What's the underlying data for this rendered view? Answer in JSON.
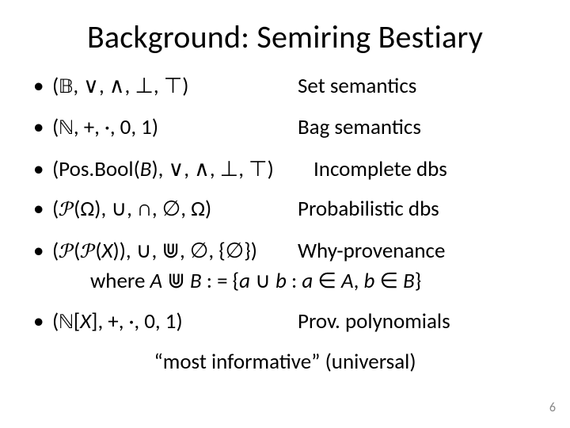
{
  "title": "Background: Semiring Bestiary",
  "items": [
    {
      "lhs_html": "(<span class='bb'>𝔹</span>, ∨, ∧, ⊥, ⊤)",
      "rhs": "Set semantics"
    },
    {
      "lhs_html": "(<span class='bb'>ℕ</span>, +, ·, 0, 1)",
      "rhs": "Bag semantics"
    },
    {
      "lhs_html": "(Pos.Bool(<span class='ital'>B</span>), ∨, ∧, ⊥, ⊤)",
      "rhs": "Incomplete dbs"
    },
    {
      "lhs_html": "(<span class='scr'>𝒫</span>(Ω), ∪, ∩, ∅, Ω)",
      "rhs": "Probabilistic dbs"
    },
    {
      "lhs_html": "(<span class='scr'>𝒫</span>(<span class='scr'>𝒫</span>(<span class='ital'>X</span>)), ∪, ⋓, ∅, {∅})",
      "rhs": "Why-provenance",
      "sub_html": "where <span class='ital'>A</span> ⋓ <span class='ital'>B</span> : = {<span class='ital'>a</span> ∪ <span class='ital'>b</span> : <span class='ital'>a</span> ∈ <span class='ital'>A</span>, <span class='ital'>b</span> ∈ <span class='ital'>B</span>}"
    },
    {
      "lhs_html": "(<span class='bb'>ℕ</span>[<span class='ital'>X</span>], +, ·, 0, 1)",
      "rhs": "Prov. polynomials"
    }
  ],
  "footer": "“most informative” (universal)",
  "page_number": "6"
}
